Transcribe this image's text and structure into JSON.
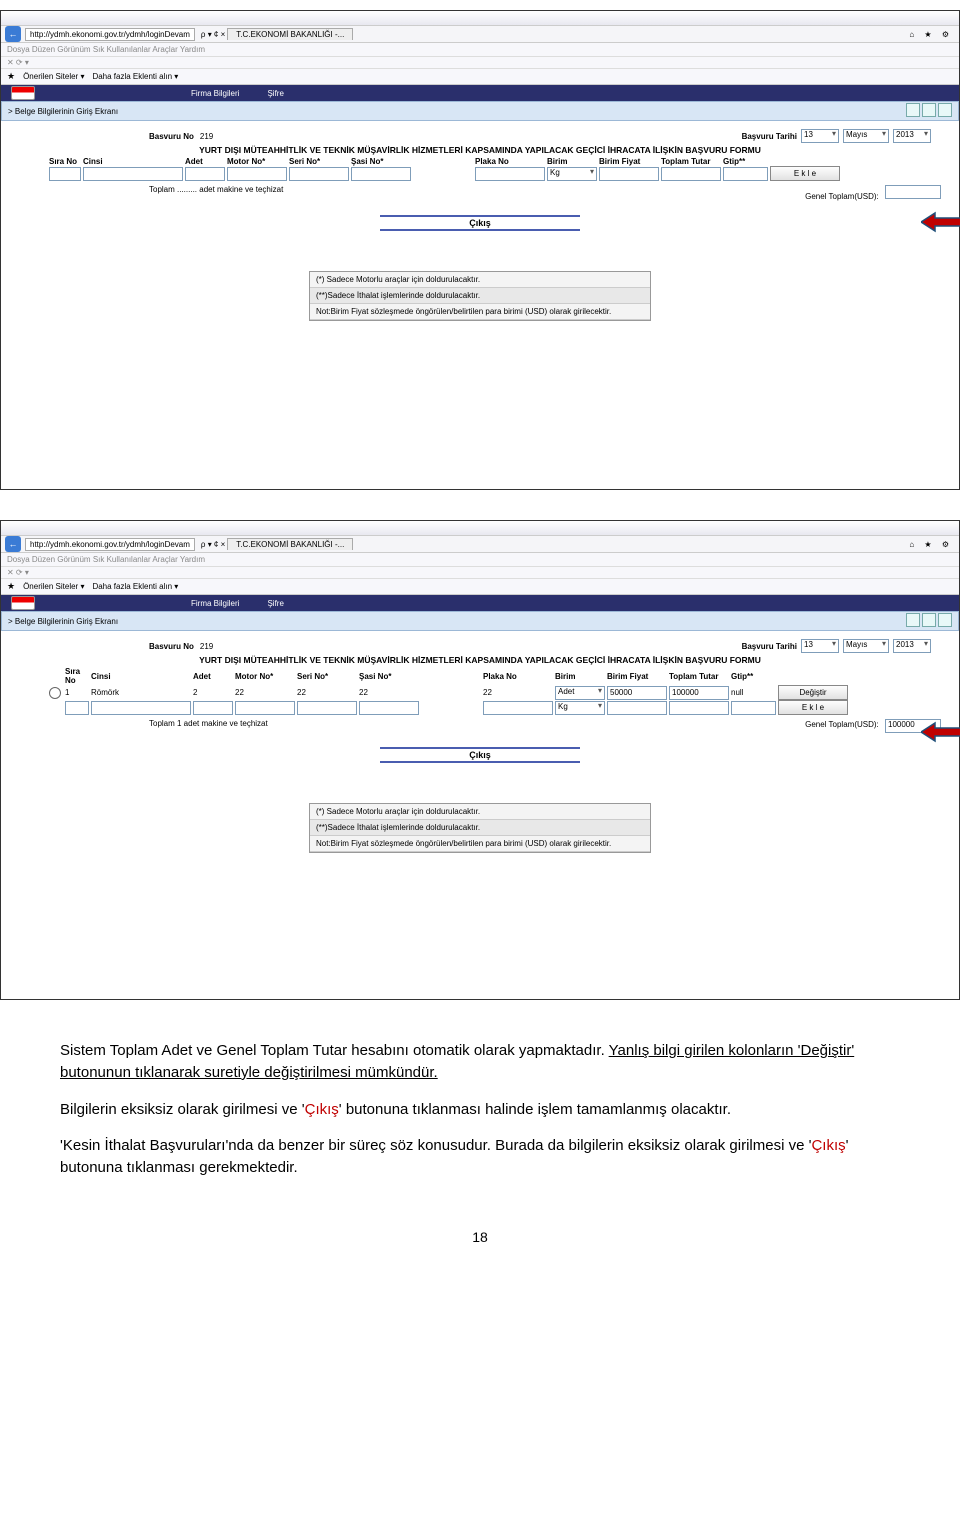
{
  "browser": {
    "url": "http://ydmh.ekonomi.gov.tr/ydmh/loginDevam",
    "search_hint": "ρ ▾ ¢ ×",
    "tab_title": "T.C.EKONOMİ BAKANLIĞI -...",
    "sys_icons": "⌂ ★ ⚙",
    "menus": "Dosya   Düzen   Görünüm   Sık Kullanılanlar   Araçlar   Yardım",
    "fav1": "Önerilen Siteler ▾",
    "fav2": "Daha fazla Eklenti alın ▾"
  },
  "nav": {
    "item1": "Firma Bilgileri",
    "item2": "Şifre"
  },
  "crumb": "> Belge  Bilgilerinin Giriş Ekranı",
  "form_top": {
    "basvuru_no_label": "Basvuru No",
    "basvuru_no": "219",
    "basvuru_tarihi_label": "Başvuru Tarihi",
    "d": "13",
    "m": "Mayıs",
    "y": "2013"
  },
  "form_title": "YURT DIŞI MÜTEAHHİTLİK VE TEKNİK MÜŞAVİRLİK HİZMETLERİ KAPSAMINDA YAPILACAK GEÇİCİ İHRACATA İLİŞKİN BAŞVURU FORMU",
  "cols": {
    "sira": "Sıra No",
    "cinsi": "Cinsi",
    "adet": "Adet",
    "motor": "Motor No*",
    "seri": "Seri No*",
    "sasi": "Şasi No*",
    "plaka": "Plaka No",
    "birim": "Birim",
    "bfiyat": "Birim Fiyat",
    "ttutar": "Toplam Tutar",
    "gtip": "Gtip**"
  },
  "unit_default": "Kg",
  "ekle": "E k l e",
  "toplam1_label": "Toplam ......... adet makine ve teçhizat",
  "genel_label": "Genel Toplam(USD):",
  "cikis": "Çıkış",
  "notes": {
    "n1": "(*) Sadece Motorlu araçlar için doldurulacaktır.",
    "n2": "(**)Sadece İthalat işlemlerinde doldurulacaktır.",
    "n3": "Not:Birim Fiyat sözleşmede öngörülen/belirtilen para birimi (USD) olarak girilecektir."
  },
  "row2": {
    "sira": "1",
    "cinsi": "Römörk",
    "adet": "2",
    "motor": "22",
    "seri": "22",
    "sasi": "22",
    "plaka": "22",
    "birim": "Adet",
    "bfiyat": "50000",
    "ttutar": "100000",
    "gtip": "null",
    "degistir": "Değiştir"
  },
  "toplam2_label": "Toplam 1 adet makine ve teçhizat",
  "genel2_val": "100000",
  "body": {
    "p1a": "Sistem Toplam Adet ve Genel Toplam Tutar hesabını otomatik olarak yapmaktadır. ",
    "p1b": "Yanlış bilgi girilen kolonların 'Değiştir' butonunun tıklanarak suretiyle değiştirilmesi mümkündür.",
    "p2a": "Bilgilerin eksiksiz olarak girilmesi ve '",
    "p2b": "Çıkış",
    "p2c": "' butonuna tıklanması halinde işlem tamamlanmış olacaktır.",
    "p3a": "'Kesin İthalat Başvuruları'nda da benzer bir süreç söz konusudur. Burada da bilgilerin eksiksiz olarak girilmesi ve '",
    "p3b": "Çıkış",
    "p3c": "' butonuna tıklanması gerekmektedir."
  },
  "page_number": "18"
}
